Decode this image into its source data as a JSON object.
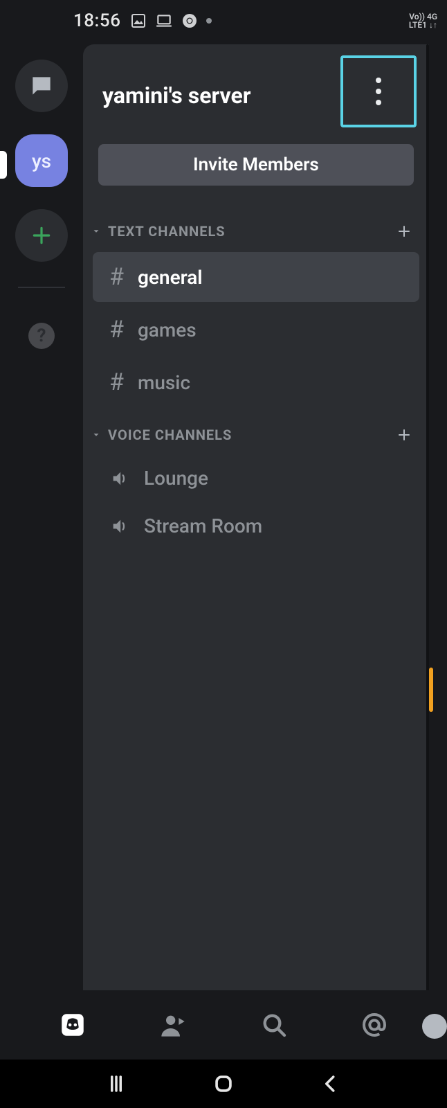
{
  "status_bar": {
    "time": "18:56",
    "network_label_top": "Vo))   4G",
    "network_label_bottom": "LTE1  ↓↑"
  },
  "server_list": {
    "active_server_initials": "ys"
  },
  "header": {
    "title": "yamini's server"
  },
  "invite_button_label": "Invite Members",
  "sections": {
    "text": {
      "label": "TEXT CHANNELS",
      "channels": [
        {
          "name": "general"
        },
        {
          "name": "games"
        },
        {
          "name": "music"
        }
      ]
    },
    "voice": {
      "label": "VOICE CHANNELS",
      "channels": [
        {
          "name": "Lounge"
        },
        {
          "name": "Stream Room"
        }
      ]
    }
  }
}
